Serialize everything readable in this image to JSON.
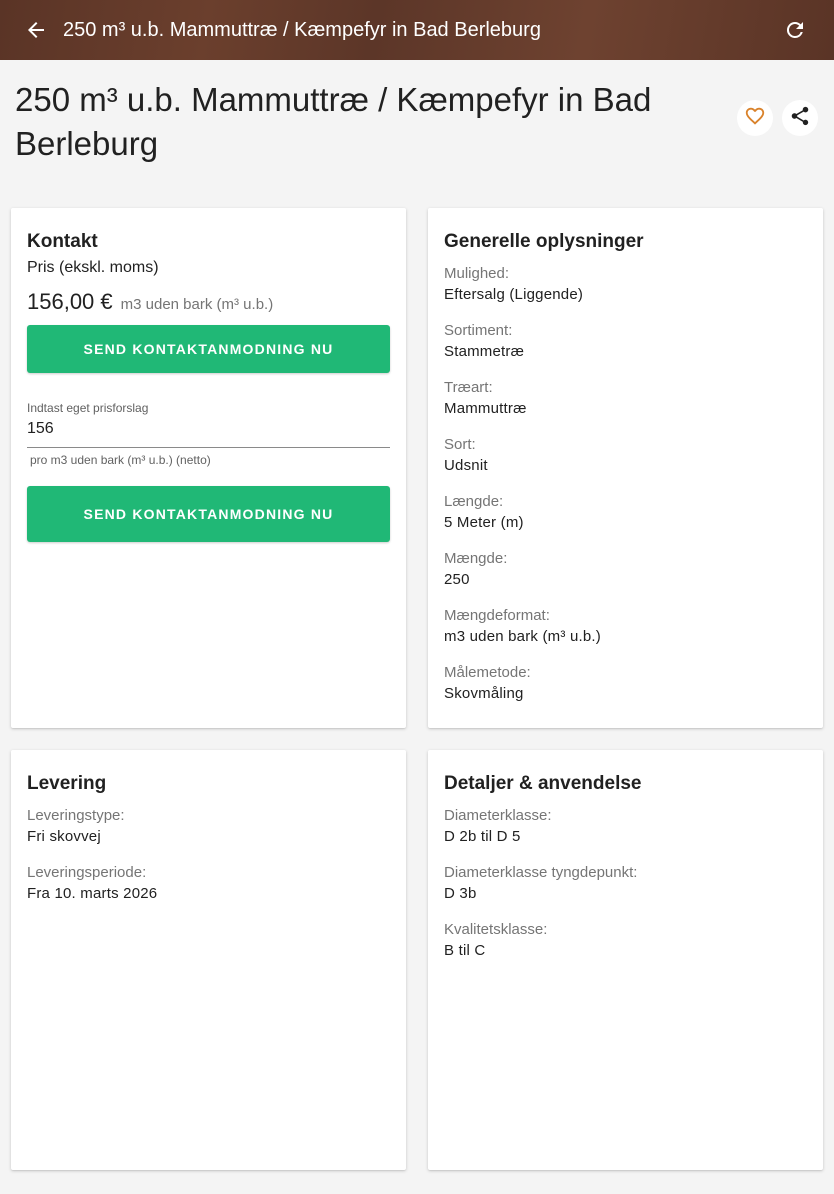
{
  "appbar": {
    "title": "250 m³ u.b. Mammuttræ / Kæmpefyr in Bad Berleburg",
    "back_icon": "arrow-left-icon",
    "refresh_icon": "refresh-icon"
  },
  "page": {
    "title": "250 m³ u.b. Mammuttræ / Kæmpefyr in Bad Berleburg",
    "favorite_icon": "heart-outline-icon",
    "share_icon": "share-icon"
  },
  "colors": {
    "accent_green": "#20b876",
    "heart_orange": "#d9822b",
    "header_brown": "#5c3628"
  },
  "contact": {
    "heading": "Kontakt",
    "price_label": "Pris (ekskl. moms)",
    "price_value": "156,00 €",
    "price_unit": "m3 uden bark (m³ u.b.)",
    "send_button_label": "SEND KONTAKTANMODNING NU",
    "offer_label": "Indtast eget prisforslag",
    "offer_value": "156",
    "offer_hint": "pro m3 uden bark (m³ u.b.) (netto)",
    "send_button2_label": "SEND KONTAKTANMODNING NU"
  },
  "general": {
    "heading": "Generelle oplysninger",
    "fields": [
      {
        "label": "Mulighed:",
        "value": "Eftersalg (Liggende)"
      },
      {
        "label": "Sortiment:",
        "value": "Stammetræ"
      },
      {
        "label": "Træart:",
        "value": "Mammuttræ"
      },
      {
        "label": "Sort:",
        "value": "Udsnit"
      },
      {
        "label": "Længde:",
        "value": "5 Meter (m)"
      },
      {
        "label": "Mængde:",
        "value": "250"
      },
      {
        "label": "Mængdeformat:",
        "value": "m3 uden bark (m³ u.b.)"
      },
      {
        "label": "Målemetode:",
        "value": "Skovmåling"
      }
    ]
  },
  "delivery": {
    "heading": "Levering",
    "fields": [
      {
        "label": "Leveringstype:",
        "value": "Fri skovvej"
      },
      {
        "label": "Leveringsperiode:",
        "value": "Fra 10. marts 2026"
      }
    ]
  },
  "details": {
    "heading": "Detaljer & anvendelse",
    "fields": [
      {
        "label": "Diameterklasse:",
        "value": "D 2b til D 5"
      },
      {
        "label": "Diameterklasse tyngdepunkt:",
        "value": "D 3b"
      },
      {
        "label": "Kvalitetsklasse:",
        "value": "B til C"
      }
    ]
  }
}
